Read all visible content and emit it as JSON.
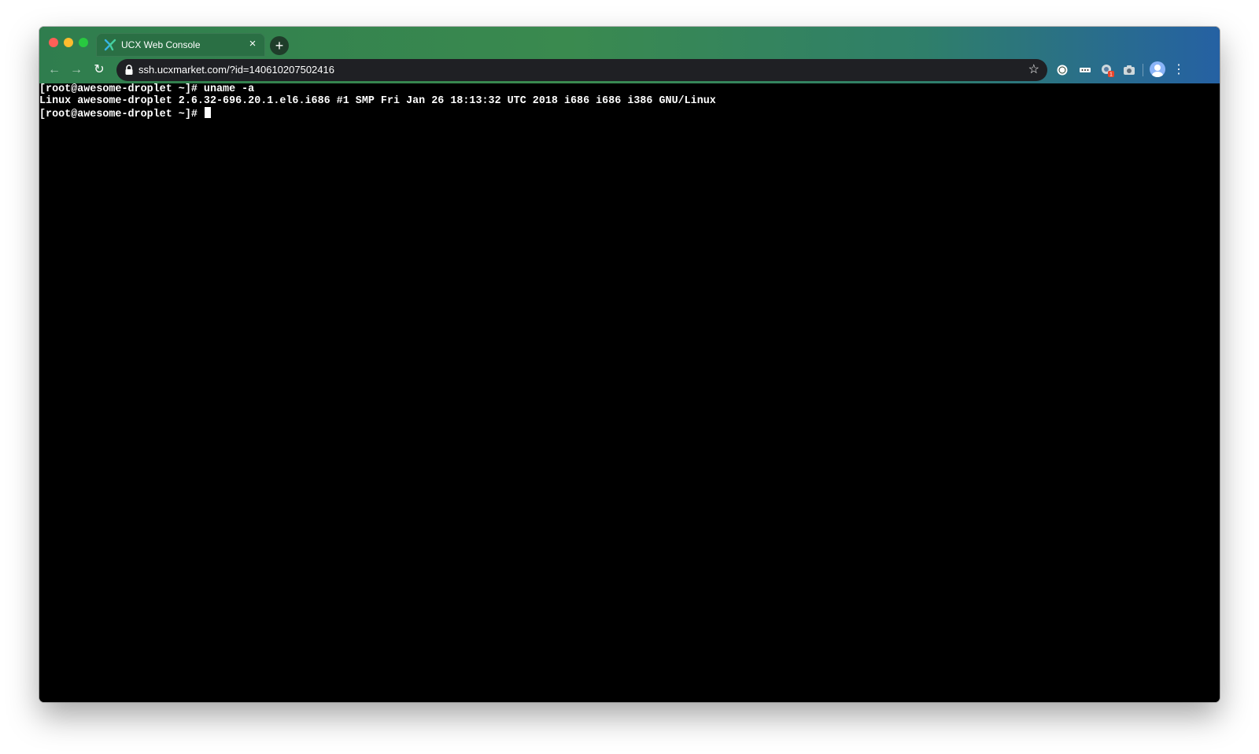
{
  "tab": {
    "title": "UCX Web Console",
    "close_glyph": "×"
  },
  "new_tab_glyph": "+",
  "nav": {
    "back_glyph": "←",
    "forward_glyph": "→",
    "reload_glyph": "↻"
  },
  "omnibox": {
    "url": "ssh.ucxmarket.com/?id=140610207502416",
    "star_glyph": "☆"
  },
  "menu_glyph": "⋮",
  "terminal": {
    "lines": [
      "[root@awesome-droplet ~]# uname -a",
      "Linux awesome-droplet 2.6.32-696.20.1.el6.i686 #1 SMP Fri Jan 26 18:13:32 UTC 2018 i686 i686 i386 GNU/Linux",
      "[root@awesome-droplet ~]# "
    ]
  },
  "colors": {
    "terminal_bg": "#000000",
    "terminal_fg": "#ffffff",
    "chrome_green": "#2f7d4e",
    "chrome_blue": "#2561a3"
  }
}
